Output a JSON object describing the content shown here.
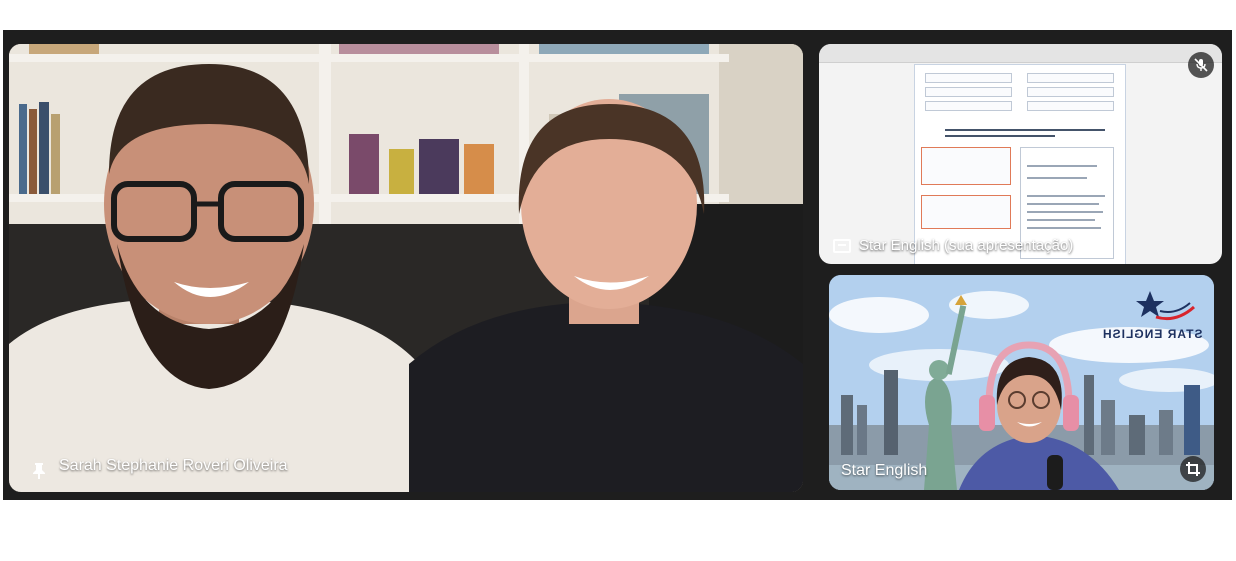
{
  "participants": {
    "main": {
      "name": "Sarah Stephanie Roveri Oliveira",
      "pinned": true,
      "icon": "pin-icon"
    },
    "presentation": {
      "label": "Star English (sua apresentação)",
      "icon": "present-to-all-icon",
      "muted": true,
      "muted_icon": "mic-off-icon"
    },
    "star": {
      "name": "Star English",
      "icon": "crop-icon",
      "logo_text": "STAR ENGLISH"
    }
  },
  "colors": {
    "stage_background": "#1e1e1e",
    "label_text": "#ffffff",
    "logo_navy": "#1d3160",
    "logo_red": "#d8242c"
  }
}
